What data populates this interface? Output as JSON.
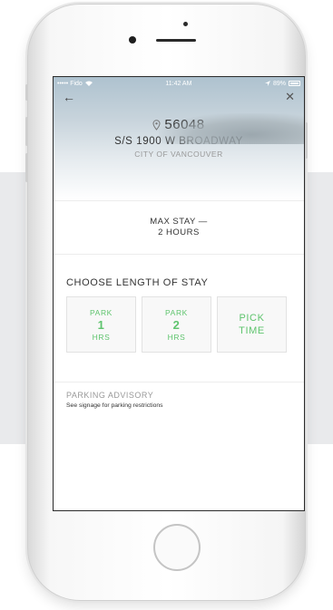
{
  "status_bar": {
    "carrier": "••••• Fido",
    "time": "11:42 AM",
    "battery": "89%"
  },
  "nav": {
    "back_icon": "back-arrow-icon",
    "close_icon": "close-icon"
  },
  "zone": {
    "number": "56048",
    "address": "S/S 1900 W BROADWAY",
    "city": "CITY OF VANCOUVER"
  },
  "max_stay": {
    "line1": "MAX STAY —",
    "line2": "2 HOURS"
  },
  "length_of_stay": {
    "title": "CHOOSE LENGTH OF STAY",
    "options": [
      {
        "top": "PARK",
        "value": "1",
        "unit": "HRS"
      },
      {
        "top": "PARK",
        "value": "2",
        "unit": "HRS"
      },
      {
        "line1": "PICK",
        "line2": "TIME"
      }
    ]
  },
  "advisory": {
    "title": "PARKING ADVISORY",
    "text": "See signage for parking restrictions"
  },
  "colors": {
    "accent_green": "#5fc46e",
    "text_dark": "#333333",
    "text_muted": "#999999"
  }
}
